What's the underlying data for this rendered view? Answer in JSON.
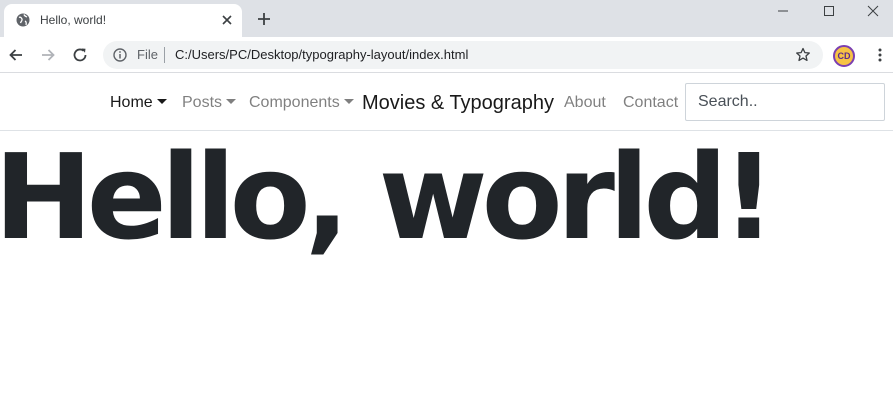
{
  "browser": {
    "tab": {
      "title": "Hello, world!"
    },
    "address": {
      "scheme_label": "File",
      "url": "C:/Users/PC/Desktop/typography-layout/index.html"
    },
    "profile": {
      "initials": "CD"
    }
  },
  "navbar": {
    "items": [
      {
        "label": "Home",
        "dropdown": true,
        "active": true
      },
      {
        "label": "Posts",
        "dropdown": true,
        "active": false
      },
      {
        "label": "Components",
        "dropdown": true,
        "active": false
      }
    ],
    "brand": "Movies & Typography",
    "links": [
      {
        "label": "About"
      },
      {
        "label": "Contact"
      }
    ],
    "search": {
      "placeholder": "Search.."
    }
  },
  "hero": {
    "heading": "Hello, world!"
  },
  "colors": {
    "text": "#212529",
    "muted_link": "#808080",
    "chrome_bg": "#dee1e6",
    "omnibox_bg": "#f1f3f4"
  },
  "icons": [
    "globe-icon",
    "close-icon",
    "plus-icon",
    "minimize-icon",
    "maximize-icon",
    "window-close-icon",
    "back-arrow-icon",
    "forward-arrow-icon",
    "reload-icon",
    "info-icon",
    "star-icon",
    "kebab-menu-icon"
  ]
}
